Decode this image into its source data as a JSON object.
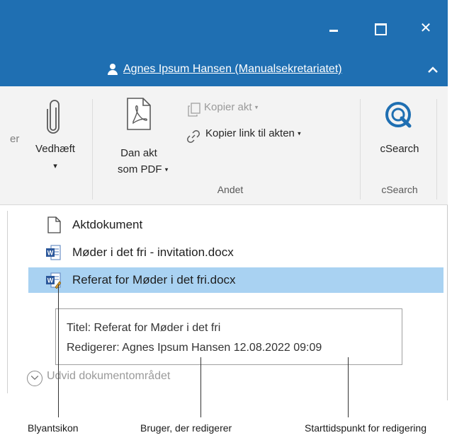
{
  "window": {
    "minimize_label": "",
    "maximize_label": "",
    "close_glyph": "✕"
  },
  "user_bar": {
    "user_name": "Agnes Ipsum Hansen (Manualsekretariatet)",
    "user_icon": "user-icon",
    "collapse_icon": "chevron-up-icon"
  },
  "ribbon": {
    "partial_label": "er",
    "attach": {
      "icon": "paperclip-icon",
      "label": "Vedhæft",
      "arrow": "▾"
    },
    "dan_akt": {
      "icon": "pdf-document-icon",
      "label_line1": "Dan akt",
      "label_line2": "som PDF",
      "arrow": "▾"
    },
    "kopier_akt": {
      "icon": "copy-document-icon",
      "label": "Kopier akt",
      "arrow": "▾",
      "enabled": false
    },
    "kopier_link": {
      "icon": "link-icon",
      "label": "Kopier link til akten",
      "arrow": "▾"
    },
    "csearch": {
      "icon": "csearch-icon",
      "label": "cSearch"
    },
    "groups": {
      "andet": "Andet",
      "csearch": "cSearch"
    }
  },
  "documents": {
    "items": [
      {
        "icon": "blank-document-icon",
        "label": "Aktdokument",
        "selected": false
      },
      {
        "icon": "word-document-icon",
        "label": "Møder i det fri - invitation.docx",
        "selected": false
      },
      {
        "icon": "word-document-editing-icon",
        "label": "Referat for Møder i det fri.docx",
        "selected": true
      }
    ],
    "expand_label": "Udvid dokumentområdet"
  },
  "tooltip": {
    "title_line": "Titel: Referat for Møder i det fri",
    "editor_line": "Redigerer: Agnes Ipsum Hansen 12.08.2022 09:09"
  },
  "callouts": {
    "pencil": "Blyantsikon",
    "user": "Bruger, der redigerer",
    "start_time": "Starttidspunkt for redigering"
  },
  "colors": {
    "title_bar": "#1f6fb2",
    "ribbon_bg": "#f3f3f3",
    "selected_row": "#a9d2f2",
    "word_blue": "#2b579a",
    "csearch_blue": "#1f6fb2"
  }
}
